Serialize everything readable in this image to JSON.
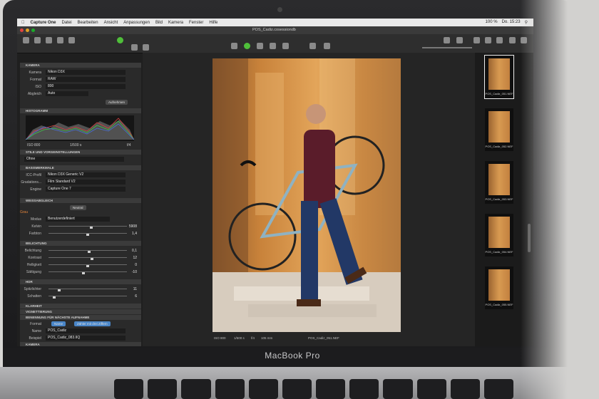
{
  "device": {
    "brand": "MacBook Pro"
  },
  "menubar": {
    "items": [
      "Capture One",
      "Datei",
      "Bearbeiten",
      "Ansicht",
      "Anpassungen",
      "Bild",
      "Kamera",
      "Fenster",
      "Hilfe"
    ],
    "status": [
      "100 %",
      "Do. 15:23"
    ]
  },
  "window": {
    "title": "POS_Cadiz.cosessiondb"
  },
  "panel": {
    "camera": {
      "header": "KAMERA",
      "rows": [
        {
          "label": "Kamera",
          "value": "Nikon D3X"
        },
        {
          "label": "Format",
          "value": "RAW"
        },
        {
          "label": "ISO",
          "value": "800"
        },
        {
          "label": "Abgleich",
          "value": "Auto"
        }
      ],
      "capture_button": "Aufnehmen"
    },
    "histogram": {
      "header": "HISTOGRAMM",
      "iso": "ISO 800",
      "shutter": "1/500 s",
      "aperture": "f/4"
    },
    "styles": {
      "header": "STILE UND VORGEINSTELLUNGEN",
      "value": "Ohne"
    },
    "base": {
      "header": "BASISMERKMALE",
      "rows": [
        {
          "label": "ICC-Profil",
          "value": "Nikon D3X Generic V2"
        },
        {
          "label": "Gradations...",
          "value": "Film Standard V2"
        },
        {
          "label": "Engine",
          "value": "Capture One 7"
        }
      ]
    },
    "white_balance": {
      "header": "WEISSABGLEICH",
      "tab": "Neutral",
      "badge": "Grau",
      "mode_label": "Modus",
      "mode_value": "Benutzerdefiniert",
      "sliders": [
        {
          "label": "Kelvin",
          "value": "5908",
          "level": 0.55
        },
        {
          "label": "Farbton",
          "value": "1,4",
          "level": 0.5
        }
      ]
    },
    "exposure": {
      "header": "BELICHTUNG",
      "sliders": [
        {
          "label": "Belichtung",
          "value": "0,1",
          "level": 0.52
        },
        {
          "label": "Kontrast",
          "value": "12",
          "level": 0.56
        },
        {
          "label": "Helligkeit",
          "value": "0",
          "level": 0.5
        },
        {
          "label": "Sättigung",
          "value": "-10",
          "level": 0.44
        }
      ]
    },
    "hdr": {
      "header": "HDR",
      "sliders": [
        {
          "label": "Spitzlichter",
          "value": "11",
          "level": 0.12
        },
        {
          "label": "Schatten",
          "value": "6",
          "level": 0.06
        }
      ]
    },
    "collapsed": [
      "KLARHEIT",
      "VIGNETTIERUNG"
    ],
    "naming": {
      "header": "BENENNUNG FÜR NÄCHSTE AUFNAHME",
      "format_label": "Format",
      "format_tokens": [
        "Name",
        "Zähler mit drei Ziffern"
      ],
      "name_label": "Name",
      "name_value": "POS_Cadiz",
      "example_label": "Beispiel",
      "example_value": "POS_Cadiz_083.IIQ"
    },
    "last_header": "KAMERA"
  },
  "viewer": {
    "iso": "ISO 800",
    "shutter": "1/500 s",
    "aperture": "f/4",
    "focal": "105 mm",
    "filename": "POS_Cadiz_051.NEF"
  },
  "filmstrip": {
    "items": [
      "POS_Cadiz_051.NEF",
      "POS_Cadiz_052.NEF",
      "POS_Cadiz_053.NEF",
      "POS_Cadiz_054.NEF",
      "POS_Cadiz_055.NEF"
    ]
  },
  "colors": {
    "accent_green": "#4fbf3a",
    "panel_bg": "#2a2a2a",
    "active_token": "#4a86c8"
  }
}
